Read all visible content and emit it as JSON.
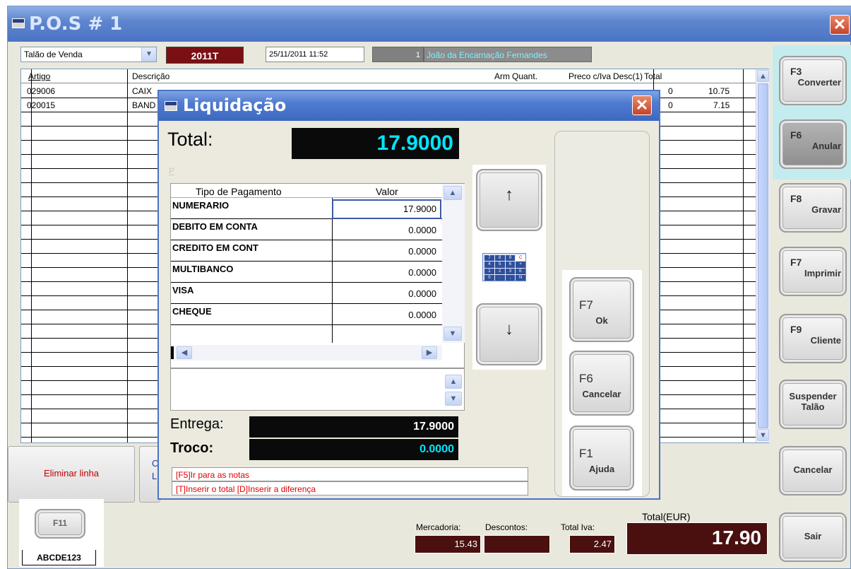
{
  "window": {
    "title": "P.O.S # 1"
  },
  "header": {
    "doc_type": "Talão de Venda",
    "series": "2011T",
    "datetime": "25/11/2011 11:52",
    "client_id": "1",
    "client_name": "João da Encarnação Fernandes"
  },
  "grid": {
    "columns": [
      "Artigo",
      "Descrição",
      "Arm",
      "Quant.",
      "Preco c/Iva",
      "Desc(1)",
      "Total"
    ],
    "rows": [
      {
        "artigo": "029006",
        "descricao": "CAIX",
        "desc_frag": "0",
        "total": "10.75"
      },
      {
        "artigo": "020015",
        "descricao": "BAND",
        "desc_frag": "0",
        "total": "7.15"
      }
    ]
  },
  "bottom_left": {
    "delete_line": "Eliminar linha",
    "partial_letters": [
      "O",
      "L"
    ],
    "f11": "F11",
    "code": "ABCDE123"
  },
  "totals": {
    "mercadoria_label": "Mercadoria:",
    "mercadoria": "15.43",
    "descontos_label": "Descontos:",
    "descontos": "",
    "total_iva_label": "Total Iva:",
    "total_iva": "2.47",
    "total_label": "Total(EUR)",
    "total": "17.90"
  },
  "side_buttons": [
    {
      "key": "F3",
      "label": "Converter"
    },
    {
      "key": "F6",
      "label": "Anular"
    },
    {
      "key": "F8",
      "label": "Gravar"
    },
    {
      "key": "F7",
      "label": "Imprimir"
    },
    {
      "key": "F9",
      "label": "Cliente"
    },
    {
      "key": "",
      "label": "Suspender Talão"
    },
    {
      "key": "",
      "label": "Cancelar"
    },
    {
      "key": "",
      "label": "Sair"
    }
  ],
  "dialog": {
    "title": "Liquidação",
    "total_label": "Total:",
    "total_value": "17.9000",
    "p_marker": "P",
    "pay_header_type": "Tipo de Pagamento",
    "pay_header_value": "Valor",
    "payments": [
      {
        "type": "NUMERARIO",
        "value": "17.9000"
      },
      {
        "type": "DEBITO EM CONTA",
        "value": "0.0000"
      },
      {
        "type": "CREDITO EM CONT",
        "value": "0.0000"
      },
      {
        "type": "MULTIBANCO",
        "value": "0.0000"
      },
      {
        "type": "VISA",
        "value": "0.0000"
      },
      {
        "type": "CHEQUE",
        "value": "0.0000"
      }
    ],
    "entrega_label": "Entrega:",
    "entrega_value": "17.9000",
    "troco_label": "Troco:",
    "troco_value": "0.0000",
    "hint1": "[F5]Ir para as notas",
    "hint2": "[T]Inserir o total  [D]Inserir a diferença",
    "buttons": [
      {
        "key": "F7",
        "label": "Ok"
      },
      {
        "key": "F6",
        "label": "Cancelar"
      },
      {
        "key": "F1",
        "label": "Ajuda"
      }
    ],
    "keypad_keys": [
      "7",
      "8",
      "9",
      "C",
      "4",
      "5",
      "6",
      "+",
      "1",
      "2",
      "3",
      "E",
      "0",
      ".",
      ",",
      "N"
    ]
  },
  "colors": {
    "title_blue": "#4a74c4",
    "dark_red": "#4a1010",
    "cyan_accent": "#00e5ff",
    "hint_red": "#e00000"
  }
}
